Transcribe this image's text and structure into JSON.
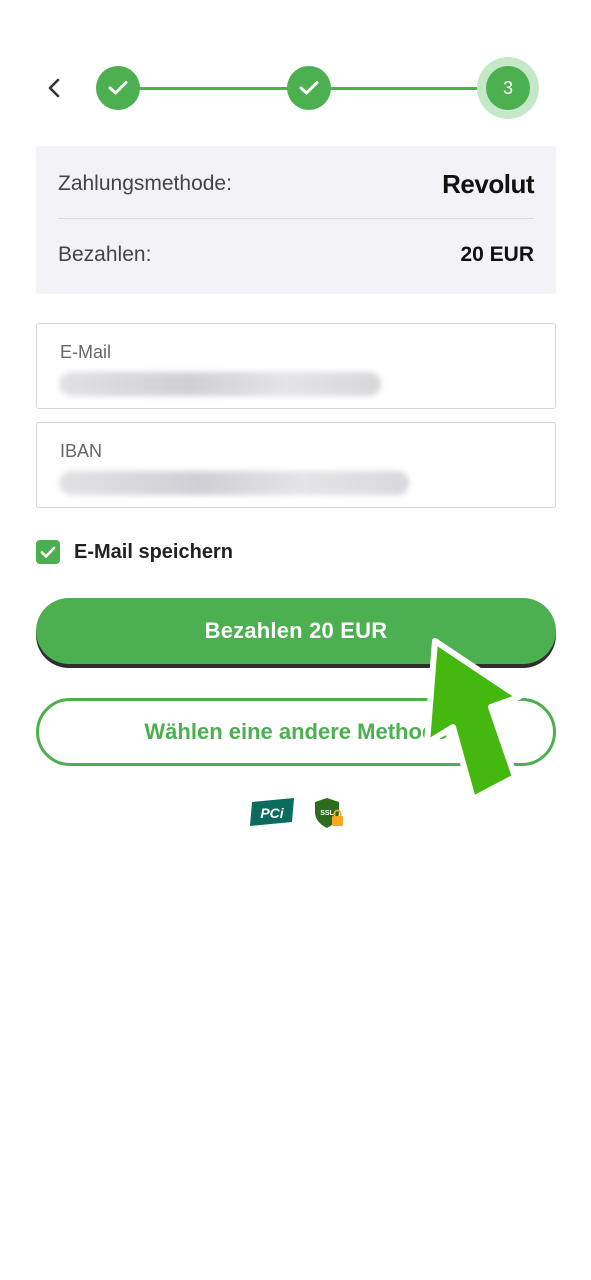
{
  "stepper": {
    "steps": [
      {
        "state": "done",
        "icon": "check-icon"
      },
      {
        "state": "done",
        "icon": "check-icon"
      },
      {
        "state": "current",
        "label": "3"
      }
    ],
    "accent": "#4caf50"
  },
  "summary": {
    "method_label": "Zahlungsmethode:",
    "method_value": "Revolut",
    "pay_label": "Bezahlen:",
    "pay_amount": "20 EUR"
  },
  "form": {
    "email": {
      "label": "E-Mail"
    },
    "iban": {
      "label": "IBAN"
    }
  },
  "save_email": {
    "label": "E-Mail speichern",
    "checked": true
  },
  "buttons": {
    "pay": "Bezahlen 20 EUR",
    "other_method": "Wählen eine andere Methode"
  },
  "badges": {
    "pci": "PCi",
    "ssl": "SSL"
  },
  "colors": {
    "primary": "#4caf50",
    "summary_bg": "#f3f3f7",
    "arrow": "#44b80f"
  }
}
